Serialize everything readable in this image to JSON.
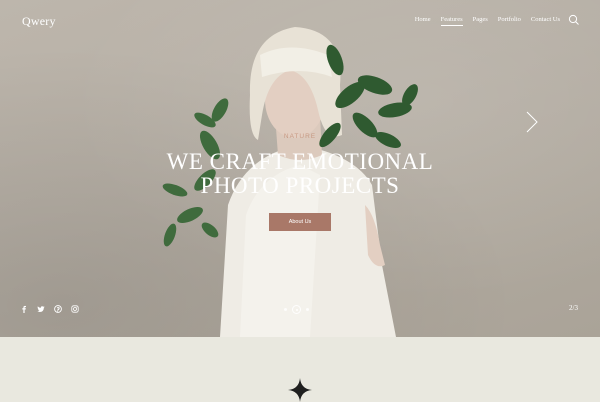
{
  "site": {
    "logo": "Qwery"
  },
  "nav": {
    "items": [
      {
        "label": "Home",
        "active": false
      },
      {
        "label": "Features",
        "active": true
      },
      {
        "label": "Pages",
        "active": false
      },
      {
        "label": "Portfolio",
        "active": false
      },
      {
        "label": "Contact Us",
        "active": false
      }
    ],
    "search_icon": "search-icon"
  },
  "hero": {
    "tag": "NATURE",
    "headline_line1": "WE CRAFT EMOTIONAL",
    "headline_line2": "PHOTO PROJECTS",
    "cta_label": "About Us",
    "next_icon": "chevron-right-icon",
    "slide_counter": "2/3",
    "slide_total": 3,
    "slide_current": 2
  },
  "socials": [
    {
      "icon": "facebook-icon"
    },
    {
      "icon": "twitter-icon"
    },
    {
      "icon": "pinterest-icon"
    },
    {
      "icon": "instagram-icon"
    }
  ],
  "colors": {
    "accent": "#a97868",
    "tag": "#c89a84",
    "page_bg": "#e9e8df",
    "hero_bg": "#b8b1a7"
  }
}
